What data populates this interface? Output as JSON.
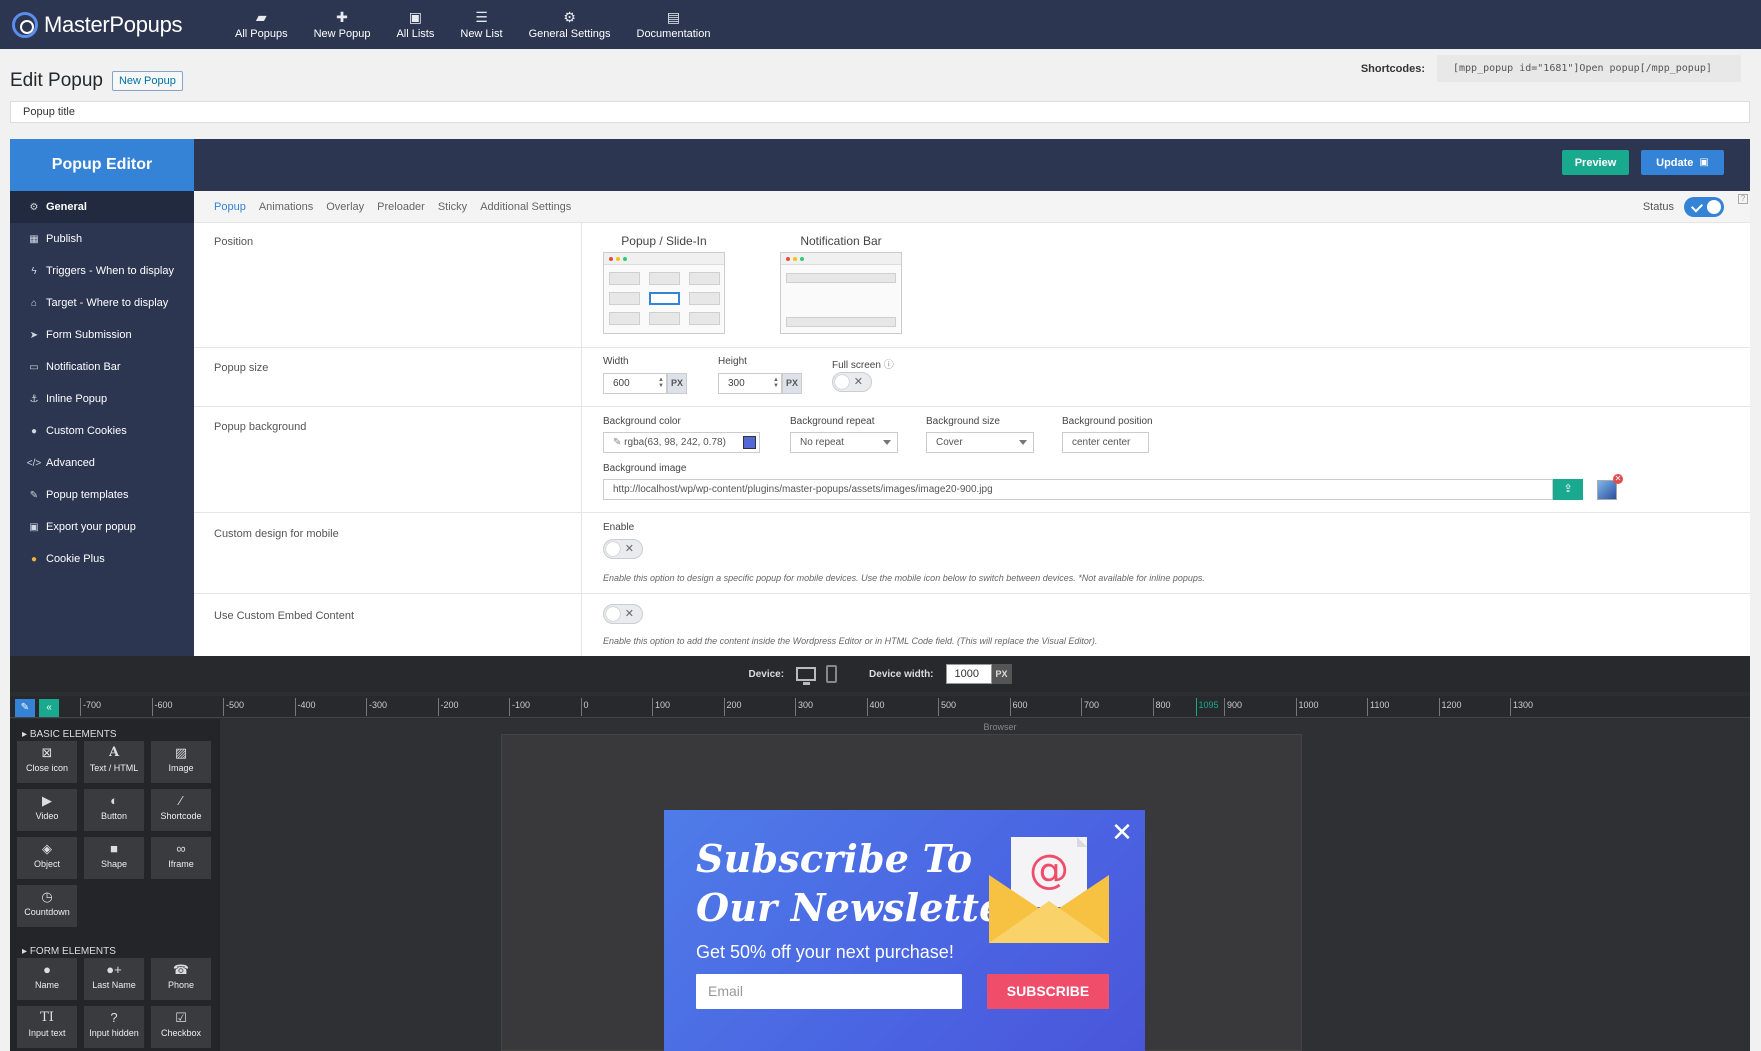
{
  "app": {
    "brand": "MasterPopups",
    "nav": [
      {
        "label": "All Popups",
        "icon": "folder-open-icon"
      },
      {
        "label": "New Popup",
        "icon": "plus-icon"
      },
      {
        "label": "All Lists",
        "icon": "address-book-icon"
      },
      {
        "label": "New List",
        "icon": "list-icon"
      },
      {
        "label": "General Settings",
        "icon": "gear-icon"
      },
      {
        "label": "Documentation",
        "icon": "document-icon"
      }
    ]
  },
  "page": {
    "title": "Edit Popup",
    "new_popup_button": "New Popup",
    "shortcodes_label": "Shortcodes:",
    "shortcode": "[mpp_popup id=\"1681\"]Open popup[/mpp_popup]",
    "popup_title_value": "Popup title"
  },
  "editor": {
    "title": "Popup Editor",
    "preview_button": "Preview",
    "update_button": "Update",
    "sidebar": [
      {
        "label": "General",
        "icon": "gear-icon",
        "active": true
      },
      {
        "label": "Publish",
        "icon": "calendar-icon"
      },
      {
        "label": "Triggers - When to display",
        "icon": "bolt-icon"
      },
      {
        "label": "Target - Where to display",
        "icon": "home-icon"
      },
      {
        "label": "Form Submission",
        "icon": "paper-plane-icon"
      },
      {
        "label": "Notification Bar",
        "icon": "window-icon"
      },
      {
        "label": "Inline Popup",
        "icon": "anchor-icon"
      },
      {
        "label": "Custom Cookies",
        "icon": "circle-icon"
      },
      {
        "label": "Advanced",
        "icon": "code-icon"
      },
      {
        "label": "Popup templates",
        "icon": "brush-icon"
      },
      {
        "label": "Export your popup",
        "icon": "save-icon"
      },
      {
        "label": "Cookie Plus",
        "icon": "cookie-icon"
      }
    ],
    "tabs": [
      "Popup",
      "Animations",
      "Overlay",
      "Preloader",
      "Sticky",
      "Additional Settings"
    ],
    "status_label": "Status",
    "status_on": true
  },
  "fields": {
    "position_label": "Position",
    "position_popup_title": "Popup / Slide-In",
    "position_notification_title": "Notification Bar",
    "size_label": "Popup size",
    "width_label": "Width",
    "width_value": "600",
    "height_label": "Height",
    "height_value": "300",
    "unit": "PX",
    "fullscreen_label": "Full screen",
    "background_label": "Popup background",
    "bg_color_label": "Background color",
    "bg_color_value": "rgba(63, 98, 242, 0.78)",
    "bg_color_swatch": "#5568d8",
    "bg_repeat_label": "Background repeat",
    "bg_repeat_value": "No repeat",
    "bg_size_label": "Background size",
    "bg_size_value": "Cover",
    "bg_position_label": "Background position",
    "bg_position_value": "center center",
    "bg_image_label": "Background image",
    "bg_image_value": "http://localhost/wp/wp-content/plugins/master-popups/assets/images/image20-900.jpg",
    "mobile_label": "Custom design for mobile",
    "mobile_enable_label": "Enable",
    "mobile_help": "Enable this option to design a specific popup for mobile devices. Use the mobile icon below to switch between devices. *Not available for inline popups.",
    "embed_label": "Use Custom Embed Content",
    "embed_help": "Enable this option to add the content inside the Wordpress Editor or in HTML Code field. (This will replace the Visual Editor)."
  },
  "visual": {
    "device_label": "Device:",
    "device_width_label": "Device width:",
    "device_width_value": "1000",
    "unit": "PX",
    "ruler_ticks": [
      "-700",
      "-600",
      "-500",
      "-400",
      "-300",
      "-200",
      "-100",
      "0",
      "100",
      "200",
      "300",
      "400",
      "500",
      "600",
      "700",
      "800",
      "1095",
      "900",
      "1000",
      "1100",
      "1200",
      "1300"
    ],
    "basic_heading": "BASIC ELEMENTS",
    "basic_elements": [
      {
        "label": "Close icon",
        "icon": "close-box-icon"
      },
      {
        "label": "Text / HTML",
        "icon": "text-icon"
      },
      {
        "label": "Image",
        "icon": "image-icon"
      },
      {
        "label": "Video",
        "icon": "video-icon"
      },
      {
        "label": "Button",
        "icon": "toggle-icon"
      },
      {
        "label": "Shortcode",
        "icon": "magic-wand-icon"
      },
      {
        "label": "Object",
        "icon": "cube-icon"
      },
      {
        "label": "Shape",
        "icon": "square-icon"
      },
      {
        "label": "Iframe",
        "icon": "link-icon"
      },
      {
        "label": "Countdown",
        "icon": "clock-icon"
      }
    ],
    "form_heading": "FORM ELEMENTS",
    "form_elements": [
      {
        "label": "Name",
        "icon": "user-icon"
      },
      {
        "label": "Last Name",
        "icon": "user-plus-icon"
      },
      {
        "label": "Phone",
        "icon": "phone-icon"
      },
      {
        "label": "Input text",
        "icon": "text-cursor-icon"
      },
      {
        "label": "Input hidden",
        "icon": "question-icon"
      },
      {
        "label": "Checkbox",
        "icon": "checkbox-icon"
      }
    ],
    "browser_label": "Browser"
  },
  "popup_preview": {
    "title_line1": "Subscribe To",
    "title_line2": "Our Newsletter",
    "subtitle": "Get 50% off your next purchase!",
    "email_placeholder": "Email",
    "button": "SUBSCRIBE",
    "close": "✕",
    "accent": "#f04d6a"
  }
}
